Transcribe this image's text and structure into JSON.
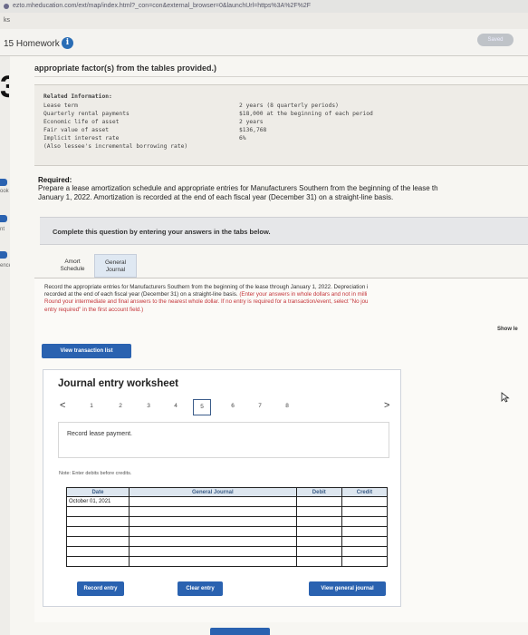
{
  "browser": {
    "url": "ezto.mheducation.com/ext/map/index.html?_con=con&external_browser=0&launchUrl=https%3A%2F%2F",
    "tab_fragment": "ks"
  },
  "homework": {
    "title": "15 Homework",
    "saved_label": "Saved",
    "question_number": "3"
  },
  "sidebar": {
    "book_label": "ook",
    "print_label": "nt",
    "references_label": "ences"
  },
  "instruction": "appropriate factor(s) from the tables provided.)",
  "related_info": {
    "heading": "Related Information:",
    "rows": [
      {
        "label": "Lease term",
        "value": "2 years (8 quarterly periods)"
      },
      {
        "label": "Quarterly rental payments",
        "value": "$18,000 at the beginning of each period"
      },
      {
        "label": "Economic life of asset",
        "value": "2 years"
      },
      {
        "label": "Fair value of asset",
        "value": "$136,768"
      },
      {
        "label": "Implicit interest rate",
        "value": "6%"
      },
      {
        "label": "(Also lessee's incremental borrowing rate)",
        "value": ""
      }
    ]
  },
  "required": {
    "heading": "Required:",
    "line1": "Prepare a lease amortization schedule and appropriate entries for Manufacturers Southern from the beginning of the lease th",
    "line2": "January 1, 2022. Amortization is recorded at the end of each fiscal year (December 31) on a straight-line basis."
  },
  "complete_box": "Complete this question by entering your answers in the tabs below.",
  "tabs": [
    {
      "line1": "Amort",
      "line2": "Schedule"
    },
    {
      "line1": "General",
      "line2": "Journal"
    }
  ],
  "panel": {
    "line1": "Record the appropriate entries for Manufacturers Southern from the beginning of the lease through January 1, 2022. Depreciation i",
    "line2a": "recorded at the end of each fiscal year (December 31) on a straight-line basis. ",
    "line2b": "(Enter your answers in whole dollars and not in milli",
    "line3": "Round your intermediate and final answers to the nearest whole dollar. If no entry is required for a transaction/event, select \"No jou",
    "line4": "entry required\" in the first account field.)",
    "show_more": "Show le"
  },
  "buttons": {
    "view_transaction_list": "View transaction list",
    "record_entry": "Record entry",
    "clear_entry": "Clear entry",
    "view_general_journal": "View general journal"
  },
  "worksheet": {
    "title": "Journal entry worksheet",
    "prev_arrow": "<",
    "next_arrow": ">",
    "pages": [
      "1",
      "2",
      "3",
      "4",
      "5",
      "6",
      "7",
      "8"
    ],
    "current_page": "5",
    "record_text": "Record lease payment.",
    "note": "Note: Enter debits before credits.",
    "columns": {
      "date": "Date",
      "gj": "General Journal",
      "debit": "Debit",
      "credit": "Credit"
    },
    "first_date": "October 01, 2021"
  },
  "colors": {
    "accent_blue": "#2a62b0",
    "info_icon": "#2a6db5",
    "red_text": "#c4353a"
  }
}
